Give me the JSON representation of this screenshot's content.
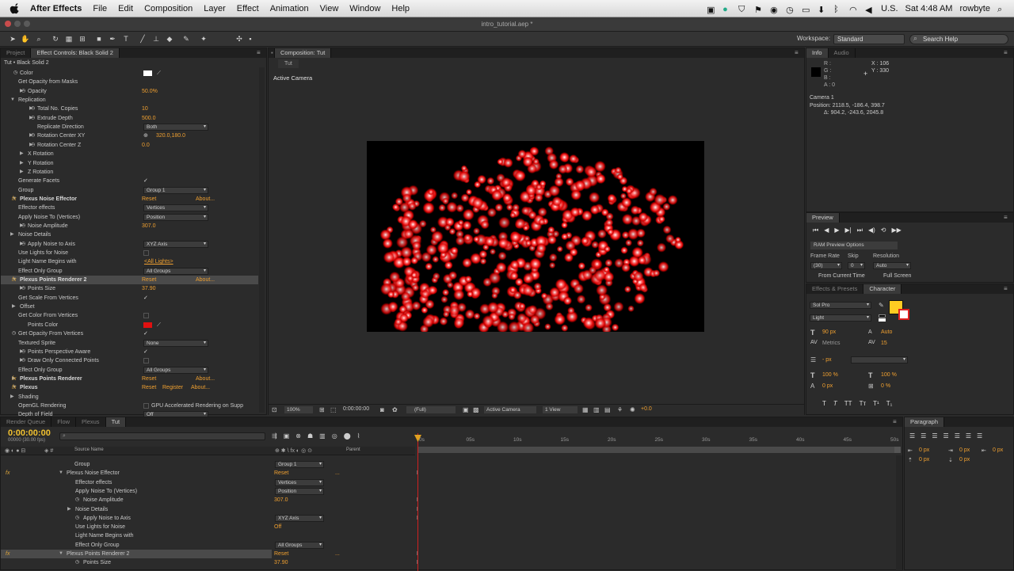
{
  "menubar": {
    "app": "After Effects",
    "items": [
      "File",
      "Edit",
      "Composition",
      "Layer",
      "Effect",
      "Animation",
      "View",
      "Window",
      "Help"
    ],
    "region": "U.S.",
    "clock": "Sat 4:48 AM",
    "user": "rowbyte"
  },
  "window": {
    "title": "intro_tutorial.aep *"
  },
  "toolbar": {
    "workspace_label": "Workspace:",
    "workspace_value": "Standard",
    "help_placeholder": "Search Help"
  },
  "effect_panel": {
    "tabs": [
      "Project",
      "Effect Controls: Black Solid 2"
    ],
    "breadcrumb": "Tut • Black Solid 2",
    "rows": [
      {
        "label": "Color",
        "value": ""
      },
      {
        "label": "Get Opacity from Masks",
        "value": ""
      },
      {
        "label": "Opacity",
        "value": "50.0%"
      },
      {
        "label": "Replication",
        "value": ""
      },
      {
        "label": "Total No. Copies",
        "value": "10"
      },
      {
        "label": "Extrude Depth",
        "value": "500.0"
      },
      {
        "label": "Replicate Direction",
        "value": "Both"
      },
      {
        "label": "Rotation Center XY",
        "value": "320.0,180.0"
      },
      {
        "label": "Rotation Center Z",
        "value": "0.0"
      },
      {
        "label": "X Rotation",
        "value": ""
      },
      {
        "label": "Y Rotation",
        "value": ""
      },
      {
        "label": "Z Rotation",
        "value": ""
      },
      {
        "label": "Generate Facets",
        "value": ""
      },
      {
        "label": "Group",
        "value": "Group 1"
      },
      {
        "label": "Plexus Noise Effector",
        "value": "Reset",
        "extra": "About..."
      },
      {
        "label": "Effector effects",
        "value": "Vertices"
      },
      {
        "label": "Apply Noise To (Vertices)",
        "value": "Position"
      },
      {
        "label": "Noise Amplitude",
        "value": "307.0"
      },
      {
        "label": "Noise Details",
        "value": ""
      },
      {
        "label": "Apply Noise to Axis",
        "value": "XYZ Axis"
      },
      {
        "label": "Use Lights for Noise",
        "value": ""
      },
      {
        "label": "Light Name Begins with",
        "value": "<All Lights>"
      },
      {
        "label": "Effect Only Group",
        "value": "All Groups"
      },
      {
        "label": "Plexus Points Renderer 2",
        "value": "Reset",
        "extra": "About..."
      },
      {
        "label": "Points Size",
        "value": "37.90"
      },
      {
        "label": "Get Scale From Vertices",
        "value": ""
      },
      {
        "label": "Offset",
        "value": ""
      },
      {
        "label": "Get Color From Vertices",
        "value": ""
      },
      {
        "label": "Points Color",
        "value": ""
      },
      {
        "label": "Get Opacity From Vertices",
        "value": ""
      },
      {
        "label": "Textured Sprite",
        "value": "None"
      },
      {
        "label": "Points Perspective Aware",
        "value": ""
      },
      {
        "label": "Draw Only Connected Points",
        "value": ""
      },
      {
        "label": "Effect Only Group",
        "value": "All Groups"
      },
      {
        "label": "Plexus Points Renderer",
        "value": "Reset",
        "extra": "About..."
      },
      {
        "label": "Plexus",
        "value": "Reset",
        "register": "Register",
        "extra": "About..."
      },
      {
        "label": "Shading",
        "value": ""
      },
      {
        "label": "OpenGL Rendering",
        "value": "GPU Accelerated Rendering on Supp"
      },
      {
        "label": "Depth of Field",
        "value": "Off"
      }
    ]
  },
  "composition": {
    "tab": "Composition: Tut",
    "subtab": "Tut",
    "camera_label": "Active Camera",
    "zoom": "100%",
    "timecode": "0:00:00:00",
    "resolution": "(Full)",
    "view": "Active Camera",
    "views": "1 View",
    "exposure": "+0.0"
  },
  "info": {
    "tabs": [
      "Info",
      "Audio"
    ],
    "r": "R :",
    "g": "G :",
    "b": "B :",
    "a": "A : 0",
    "x": "X : 106",
    "y": "Y : 330",
    "camera": "Camera 1",
    "position": "Position: 2118.5, -186.4, 398.7",
    "delta": "Δ: 904.2, -243.6, 2045.8"
  },
  "preview": {
    "tab": "Preview",
    "ram_options": "RAM Preview Options",
    "frame_rate_label": "Frame Rate",
    "skip_label": "Skip",
    "resolution_label": "Resolution",
    "frame_rate": "(30)",
    "skip": "0",
    "resolution": "Auto",
    "from_current": "From Current Time",
    "full_screen": "Full Screen"
  },
  "character": {
    "tabs": [
      "Effects & Presets",
      "Character"
    ],
    "font": "Sol Pro",
    "style": "Light",
    "size": "90 px",
    "leading": "Auto",
    "kerning": "Metrics",
    "tracking": "15",
    "stroke": "- px",
    "vscale": "100 %",
    "hscale": "100 %",
    "baseline": "0 px",
    "tsume": "0 %",
    "fill_color": "#ffcc22"
  },
  "paragraph": {
    "tab": "Paragraph",
    "v1": "0 px",
    "v2": "0 px",
    "v3": "0 px",
    "v4": "0 px",
    "v5": "0 px"
  },
  "timeline": {
    "tabs": [
      "Render Queue",
      "Flow",
      "Plexus",
      "Tut"
    ],
    "timecode": "0:00:00:00",
    "frame_info": "00000 (30.00 fps)",
    "col_source": "Source Name",
    "col_parent": "Parent",
    "ruler": [
      "0s",
      "05s",
      "10s",
      "15s",
      "20s",
      "25s",
      "30s",
      "35s",
      "40s",
      "45s",
      "50s"
    ],
    "rows": [
      {
        "label": "Group",
        "value": "Group 1"
      },
      {
        "label": "Plexus Noise Effector",
        "value": "Reset",
        "extra": "..."
      },
      {
        "label": "Effector effects",
        "value": "Vertices"
      },
      {
        "label": "Apply Noise To (Vertices)",
        "value": "Position"
      },
      {
        "label": "Noise Amplitude",
        "value": "307.0"
      },
      {
        "label": "Noise Details",
        "value": ""
      },
      {
        "label": "Apply Noise to Axis",
        "value": "XYZ Axis"
      },
      {
        "label": "Use Lights for Noise",
        "value": "Off"
      },
      {
        "label": "Light Name Begins with",
        "value": ""
      },
      {
        "label": "Effect Only Group",
        "value": "All Groups"
      },
      {
        "label": "Plexus Points Renderer 2",
        "value": "Reset",
        "extra": "..."
      },
      {
        "label": "Points Size",
        "value": "37.90"
      }
    ]
  },
  "colors": {
    "accent": "#f0a030",
    "points": "#e01010",
    "panel": "#2b2b2b"
  }
}
